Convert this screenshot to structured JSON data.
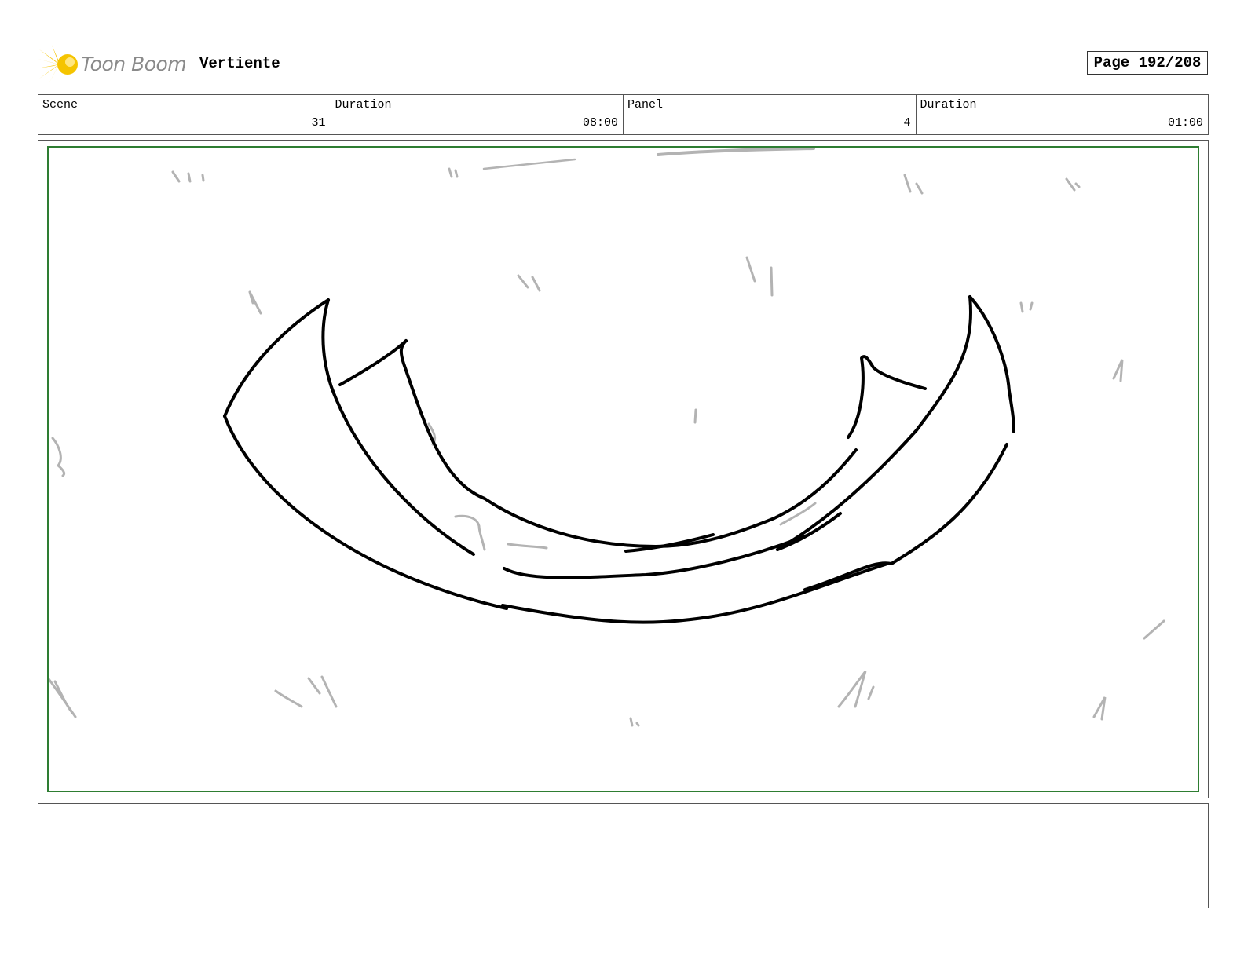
{
  "header": {
    "logo_text": "Toon Boom",
    "project_title": "Vertiente",
    "page_label": "Page 192/208"
  },
  "info": {
    "scene_label": "Scene",
    "scene_value": "31",
    "scene_duration_label": "Duration",
    "scene_duration_value": "08:00",
    "panel_label": "Panel",
    "panel_value": "4",
    "panel_duration_label": "Duration",
    "panel_duration_value": "01:00"
  },
  "colors": {
    "frame_border": "#2e7d32",
    "sketch_line": "#000000",
    "sketch_grey": "#b3b3b3",
    "logo_yellow": "#f5c400"
  },
  "icons": {
    "logo": "toon-boom-sun-logo"
  },
  "notes": {
    "text": ""
  }
}
